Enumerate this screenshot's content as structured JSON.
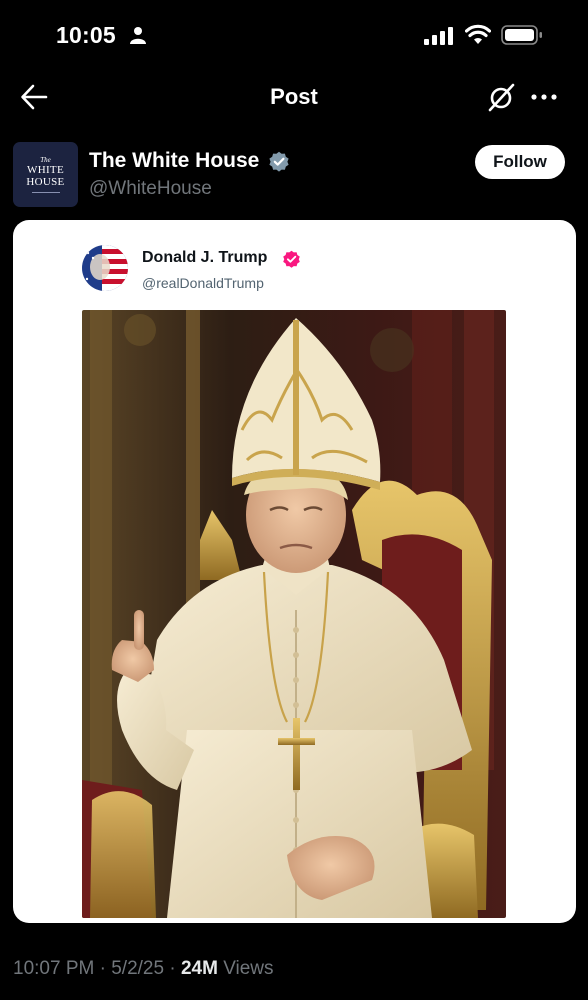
{
  "status_bar": {
    "time": "10:05",
    "icons": [
      "person-icon",
      "signal-icon",
      "wifi-icon",
      "battery-icon"
    ]
  },
  "nav": {
    "title": "Post",
    "icons": [
      "back-arrow-icon",
      "grok-icon",
      "more-icon"
    ]
  },
  "author": {
    "name": "The White House",
    "handle": "@WhiteHouse",
    "avatar_lines": [
      "The",
      "WHITE",
      "HOUSE"
    ],
    "verified_badge_color": "#829aab",
    "follow_label": "Follow"
  },
  "embedded_post": {
    "name": "Donald J. Trump",
    "handle": "@realDonaldTrump",
    "verified_badge_color": "#f91880",
    "image_subject": "papal-portrait-image"
  },
  "meta": {
    "time": "10:07 PM",
    "separator": "·",
    "date": "5/2/25",
    "views_count": "24M",
    "views_label": "Views"
  },
  "colors": {
    "background": "#000000",
    "primary_text": "#e7e9ea",
    "secondary_text": "#71767b",
    "card_background": "#ffffff"
  }
}
